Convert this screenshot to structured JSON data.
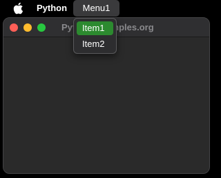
{
  "menubar": {
    "apple_icon": "apple-logo",
    "app_name": "Python",
    "menu_title": "Menu1"
  },
  "window": {
    "title": "Python-Examples.org",
    "title_visible_fragments": [
      "Py",
      "ples.org"
    ],
    "traffic_lights": {
      "close_color": "#ff5f57",
      "minimize_color": "#febc2e",
      "zoom_color": "#28c840"
    }
  },
  "dropdown": {
    "items": [
      {
        "label": "Item1",
        "highlighted": true
      },
      {
        "label": "Item2",
        "highlighted": false
      }
    ],
    "highlight_color": "#2c8a2f"
  }
}
